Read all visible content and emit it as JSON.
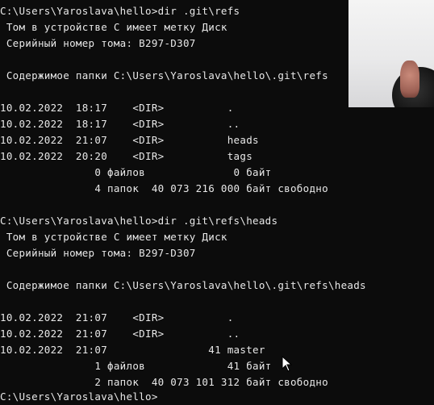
{
  "terminal": {
    "lines": [
      "C:\\Users\\Yaroslava\\hello>dir .git\\refs",
      " Том в устройстве C имеет метку Диск",
      " Серийный номер тома: B297-D307",
      "",
      " Содержимое папки C:\\Users\\Yaroslava\\hello\\.git\\refs",
      "",
      "10.02.2022  18:17    <DIR>          .",
      "10.02.2022  18:17    <DIR>          ..",
      "10.02.2022  21:07    <DIR>          heads",
      "10.02.2022  20:20    <DIR>          tags",
      "               0 файлов              0 байт",
      "               4 папок  40 073 216 000 байт свободно",
      "",
      "C:\\Users\\Yaroslava\\hello>dir .git\\refs\\heads",
      " Том в устройстве C имеет метку Диск",
      " Серийный номер тома: B297-D307",
      "",
      " Содержимое папки C:\\Users\\Yaroslava\\hello\\.git\\refs\\heads",
      "",
      "10.02.2022  21:07    <DIR>          .",
      "10.02.2022  21:07    <DIR>          ..",
      "10.02.2022  21:07                41 master",
      "               1 файлов             41 байт",
      "               2 папок  40 073 101 312 байт свободно",
      "",
      "C:\\Users\\Yaroslava\\hello>"
    ]
  },
  "colors": {
    "background": "#0c0c0c",
    "text": "#e8e8e8"
  }
}
